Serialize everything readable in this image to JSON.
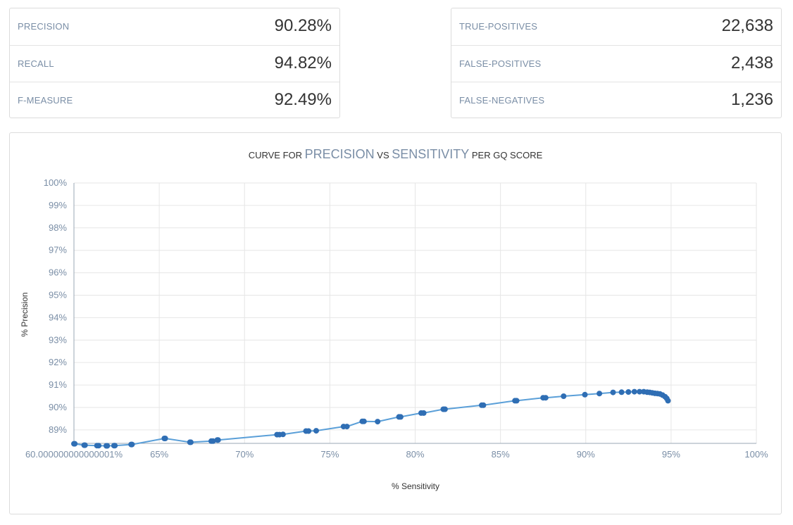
{
  "metrics_left": [
    {
      "label": "PRECISION",
      "value": "90.28%"
    },
    {
      "label": "RECALL",
      "value": "94.82%"
    },
    {
      "label": "F-MEASURE",
      "value": "92.49%"
    }
  ],
  "metrics_right": [
    {
      "label": "TRUE-POSITIVES",
      "value": "22,638"
    },
    {
      "label": "FALSE-POSITIVES",
      "value": "2,438"
    },
    {
      "label": "FALSE-NEGATIVES",
      "value": "1,236"
    }
  ],
  "chart_title": {
    "pre1": "CURVE FOR ",
    "accent1": "PRECISION",
    "mid": " VS ",
    "accent2": "SENSITIVITY",
    "post": " PER GQ SCORE"
  },
  "chart_data": {
    "type": "line",
    "title": "CURVE FOR PRECISION VS SENSITIVITY PER GQ SCORE",
    "xlabel": "% Sensitivity",
    "ylabel": "% Precision",
    "xlim": [
      60,
      100
    ],
    "ylim": [
      88.4,
      100
    ],
    "x_ticks": [
      60,
      65,
      70,
      75,
      80,
      85,
      90,
      95,
      100
    ],
    "x_tick_labels": [
      "60.000000000000001%",
      "65%",
      "70%",
      "75%",
      "80%",
      "85%",
      "90%",
      "95%",
      "100%"
    ],
    "y_ticks": [
      89,
      90,
      91,
      92,
      93,
      94,
      95,
      96,
      97,
      98,
      99,
      100
    ],
    "y_tick_labels": [
      "89%",
      "90%",
      "91%",
      "92%",
      "93%",
      "94%",
      "95%",
      "96%",
      "97%",
      "98%",
      "99%",
      "100%"
    ],
    "grid": true,
    "line_color": "#5a9fd8",
    "marker_color": "#2f6eb4",
    "series": [
      {
        "x": [
          60.0,
          60.05,
          60.6,
          60.65,
          61.35,
          61.45,
          61.9,
          61.95,
          62.35,
          62.4,
          65.3,
          65.35,
          63.35,
          63.4,
          66.8,
          66.85,
          68.05,
          68.15,
          68.4,
          68.45,
          71.9,
          72.05,
          72.25,
          73.6,
          73.75,
          74.2,
          75.8,
          76.0,
          76.9,
          77.0,
          77.8,
          79.05,
          79.15,
          80.35,
          80.5,
          81.65,
          81.75,
          83.9,
          84.0,
          85.85,
          85.95,
          87.5,
          87.65,
          88.7,
          89.95,
          90.8,
          91.6,
          92.1,
          92.5,
          92.85,
          93.15,
          93.4,
          93.6,
          93.75,
          93.9,
          94.05,
          94.2,
          94.35,
          94.5,
          94.65,
          94.75,
          94.82
        ],
        "y": [
          88.38,
          88.38,
          88.32,
          88.32,
          88.3,
          88.3,
          88.29,
          88.29,
          88.3,
          88.3,
          88.62,
          88.62,
          88.35,
          88.35,
          88.45,
          88.45,
          88.5,
          88.5,
          88.55,
          88.55,
          88.79,
          88.79,
          88.8,
          88.95,
          88.95,
          88.96,
          89.15,
          89.15,
          89.38,
          89.38,
          89.37,
          89.58,
          89.58,
          89.75,
          89.75,
          89.92,
          89.92,
          90.1,
          90.1,
          90.3,
          90.3,
          90.43,
          90.43,
          90.5,
          90.57,
          90.62,
          90.67,
          90.68,
          90.69,
          90.7,
          90.7,
          90.7,
          90.68,
          90.67,
          90.65,
          90.63,
          90.62,
          90.6,
          90.55,
          90.48,
          90.4,
          90.3
        ]
      }
    ]
  }
}
